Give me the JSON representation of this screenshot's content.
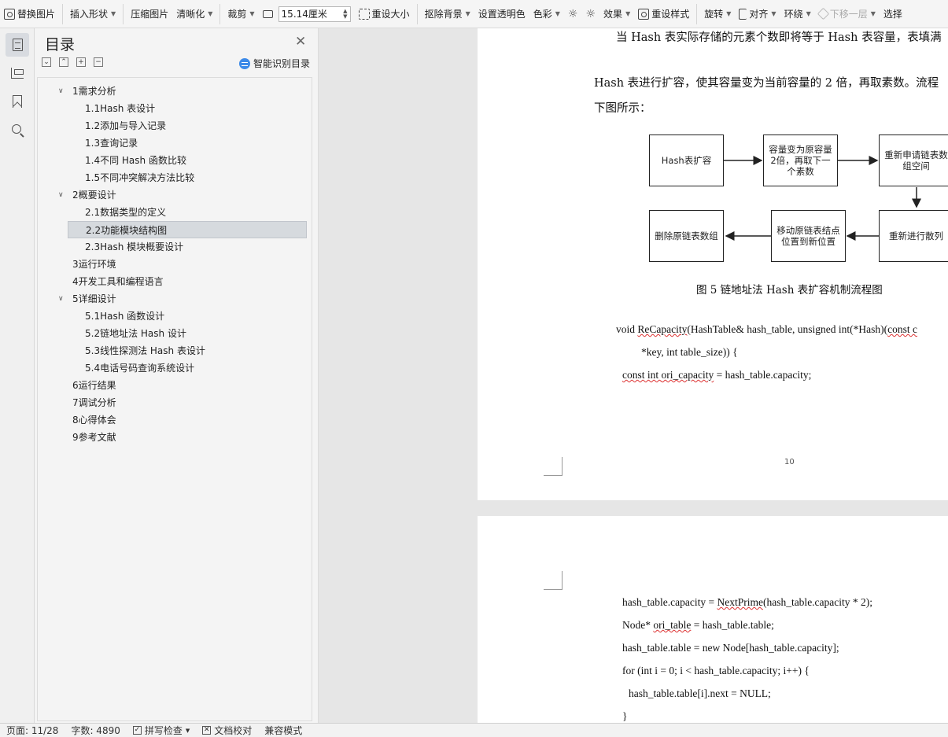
{
  "toolbar": {
    "replace_image": "替换图片",
    "insert_shape": "插入形状",
    "compress_image": "压缩图片",
    "sharpen": "清晰化",
    "crop": "裁剪",
    "size_value": "15.14厘米",
    "reset_size": "重设大小",
    "remove_background": "抠除背景",
    "set_transparent": "设置透明色",
    "color": "色彩",
    "effects": "效果",
    "reset_style": "重设样式",
    "rotate": "旋转",
    "align": "对齐",
    "wrap": "环绕",
    "send_backward": "下移一层",
    "select": "选择"
  },
  "toc": {
    "title": "目录",
    "smart_label": "智能识别目录",
    "items": [
      {
        "label": "1需求分析",
        "level": 1,
        "expanded": true
      },
      {
        "label": "1.1Hash 表设计",
        "level": 2
      },
      {
        "label": "1.2添加与导入记录",
        "level": 2
      },
      {
        "label": "1.3查询记录",
        "level": 2
      },
      {
        "label": "1.4不同 Hash 函数比较",
        "level": 2
      },
      {
        "label": "1.5不同冲突解决方法比较",
        "level": 2
      },
      {
        "label": "2概要设计",
        "level": 1,
        "expanded": true
      },
      {
        "label": "2.1数据类型的定义",
        "level": 2
      },
      {
        "label": "2.2功能模块结构图",
        "level": 2,
        "selected": true
      },
      {
        "label": "2.3Hash 模块概要设计",
        "level": 2
      },
      {
        "label": "3运行环境",
        "level": 1
      },
      {
        "label": "4开发工具和编程语言",
        "level": 1
      },
      {
        "label": "5详细设计",
        "level": 1,
        "expanded": true
      },
      {
        "label": "5.1Hash 函数设计",
        "level": 2
      },
      {
        "label": "5.2链地址法 Hash 设计",
        "level": 2
      },
      {
        "label": "5.3线性探测法 Hash 表设计",
        "level": 2
      },
      {
        "label": "5.4电话号码查询系统设计",
        "level": 2
      },
      {
        "label": "6运行结果",
        "level": 1
      },
      {
        "label": "7调试分析",
        "level": 1
      },
      {
        "label": "8心得体会",
        "level": 1
      },
      {
        "label": "9参考文献",
        "level": 1
      }
    ]
  },
  "document": {
    "para_line1": "当 Hash 表实际存储的元素个数即将等于 Hash 表容量，表填满",
    "para_line2": "Hash 表进行扩容，使其容量变为当前容量的 2 倍，再取素数。流程",
    "para_line3": "下图所示：",
    "flow": {
      "b1": "Hash表扩容",
      "b2": "容量变为原容量2倍，再取下一个素数",
      "b3": "重新申请链表数组空间",
      "b4": "重新进行散列",
      "b5": "移动原链表结点位置到新位置",
      "b6": "删除原链表数组"
    },
    "caption": "图 5 链地址法 Hash 表扩容机制流程图",
    "code1_a": "void ",
    "code1_b": "ReCapacity",
    "code1_c": "(HashTable& hash_table, unsigned int(*Hash)(",
    "code1_d": "const c",
    "code2": "*key, int table_size)) {",
    "code3_a": "const int ",
    "code3_b": "ori_capacity",
    "code3_c": " = hash_table.capacity;",
    "page_number": "10",
    "p2_code1_a": "hash_table.capacity = ",
    "p2_code1_b": "NextPrime",
    "p2_code1_c": "(hash_table.capacity * 2);",
    "p2_code2_a": "Node* ",
    "p2_code2_b": "ori_table",
    "p2_code2_c": " = hash_table.table;",
    "p2_code3": "hash_table.table = new Node[hash_table.capacity];",
    "p2_code4": "for (int i = 0; i < hash_table.capacity; i++) {",
    "p2_code5": "hash_table.table[i].next = NULL;",
    "p2_code6": "}"
  },
  "status": {
    "page": "页面: 11/28",
    "words": "字数: 4890",
    "spell_check": "拼写检查",
    "doc_proof": "文档校对",
    "compat_mode": "兼容模式"
  }
}
